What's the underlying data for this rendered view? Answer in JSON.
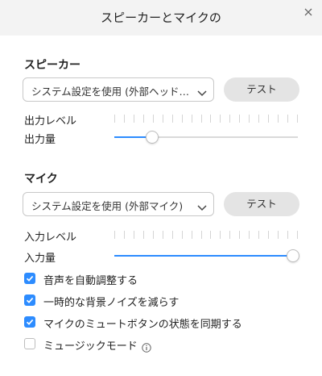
{
  "window": {
    "title": "スピーカーとマイクの"
  },
  "speaker": {
    "section_title": "スピーカー",
    "device_value": "システム設定を使用 (外部ヘッド…",
    "test_label": "テスト",
    "output_level_label": "出力レベル",
    "output_volume_label": "出力量",
    "output_volume": 0.2
  },
  "mic": {
    "section_title": "マイク",
    "device_value": "システム設定を使用 (外部マイク)",
    "test_label": "テスト",
    "input_level_label": "入力レベル",
    "input_volume_label": "入力量",
    "input_volume": 0.97
  },
  "options": [
    {
      "label": "音声を自動調整する",
      "checked": true
    },
    {
      "label": "一時的な背景ノイズを減らす",
      "checked": true
    },
    {
      "label": "マイクのミュートボタンの状態を同期する",
      "checked": true
    },
    {
      "label": "ミュージックモード",
      "checked": false
    }
  ],
  "icons": {
    "close": "close-icon",
    "chevron": "chevron-down-icon",
    "check": "checkmark-icon",
    "info": "info-icon"
  },
  "colors": {
    "accent": "#2d8cff",
    "button_bg": "#e4e4e4",
    "titlebar_bg": "#f3f3f3"
  }
}
